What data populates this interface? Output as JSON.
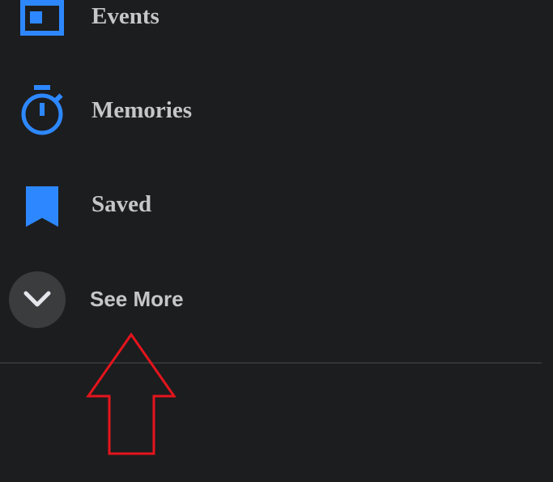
{
  "menu": {
    "items": [
      {
        "label": "Events",
        "icon": "calendar-icon"
      },
      {
        "label": "Memories",
        "icon": "stopwatch-icon"
      },
      {
        "label": "Saved",
        "icon": "bookmark-icon"
      }
    ],
    "see_more": {
      "label": "See More",
      "icon": "chevron-down-icon"
    }
  },
  "colors": {
    "background": "#1c1d1f",
    "icon_accent": "#2d88ff",
    "label_text": "#c6c6c6",
    "see_more_circle": "#3b3c3e",
    "annotation_arrow": "#e5141c"
  }
}
